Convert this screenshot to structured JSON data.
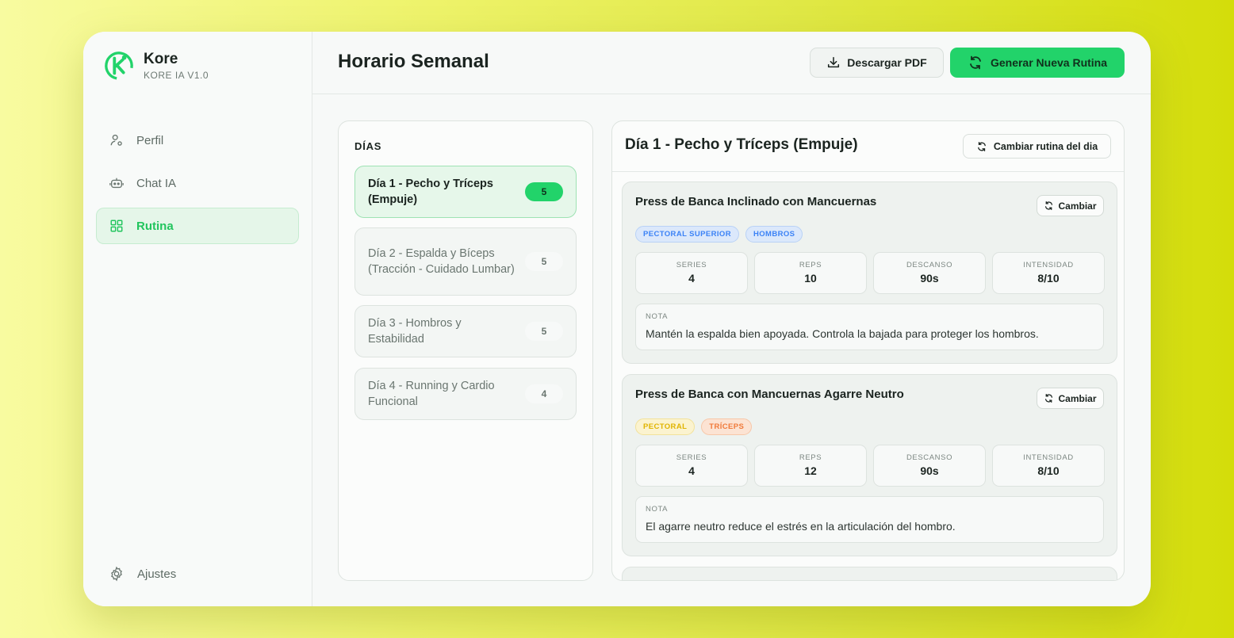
{
  "app": {
    "name": "Kore",
    "version": "KORE IA V1.0"
  },
  "sidebar": {
    "items": [
      {
        "label": "Perfil",
        "icon": "user-icon",
        "active": false
      },
      {
        "label": "Chat IA",
        "icon": "bot-icon",
        "active": false
      },
      {
        "label": "Rutina",
        "icon": "grid-icon",
        "active": true
      }
    ],
    "settings_label": "Ajustes"
  },
  "header": {
    "title": "Horario Semanal",
    "download_label": "Descargar PDF",
    "generate_label": "Generar Nueva Rutina"
  },
  "days": {
    "title": "DÍAS",
    "items": [
      {
        "label": "Día 1 - Pecho y Tríceps (Empuje)",
        "count": "5",
        "active": true
      },
      {
        "label": "Día 2 - Espalda y Bíceps (Tracción - Cuidado Lumbar)",
        "count": "5",
        "active": false
      },
      {
        "label": "Día 3 - Hombros y Estabilidad",
        "count": "5",
        "active": false
      },
      {
        "label": "Día 4 - Running y Cardio Funcional",
        "count": "4",
        "active": false
      }
    ]
  },
  "detail": {
    "title": "Día 1 - Pecho y Tríceps (Empuje)",
    "change_day_label": "Cambiar rutina del dia",
    "change_label": "Cambiar",
    "exercises": [
      {
        "name": "Press de Banca Inclinado con Mancuernas",
        "tags": [
          {
            "label": "PECTORAL SUPERIOR",
            "color": "#3b82f6",
            "bg": "#dbe8fb",
            "border": "#b9d2f6"
          },
          {
            "label": "HOMBROS",
            "color": "#3b82f6",
            "bg": "#dbe8fb",
            "border": "#b9d2f6"
          }
        ],
        "stats": [
          {
            "label": "SERIES",
            "value": "4"
          },
          {
            "label": "REPS",
            "value": "10"
          },
          {
            "label": "DESCANSO",
            "value": "90s"
          },
          {
            "label": "INTENSIDAD",
            "value": "8/10"
          }
        ],
        "note_label": "NOTA",
        "note": "Mantén la espalda bien apoyada. Controla la bajada para proteger los hombros."
      },
      {
        "name": "Press de Banca con Mancuernas Agarre Neutro",
        "tags": [
          {
            "label": "PECTORAL",
            "color": "#e0b400",
            "bg": "#fbf3cf",
            "border": "#f2e29a"
          },
          {
            "label": "TRÍCEPS",
            "color": "#f07a3a",
            "bg": "#fce3d3",
            "border": "#f7c7a8"
          }
        ],
        "stats": [
          {
            "label": "SERIES",
            "value": "4"
          },
          {
            "label": "REPS",
            "value": "12"
          },
          {
            "label": "DESCANSO",
            "value": "90s"
          },
          {
            "label": "INTENSIDAD",
            "value": "8/10"
          }
        ],
        "note_label": "NOTA",
        "note": "El agarre neutro reduce el estrés en la articulación del hombro."
      }
    ]
  },
  "colors": {
    "accent": "#22d36a",
    "accent_text": "#22c55e"
  }
}
